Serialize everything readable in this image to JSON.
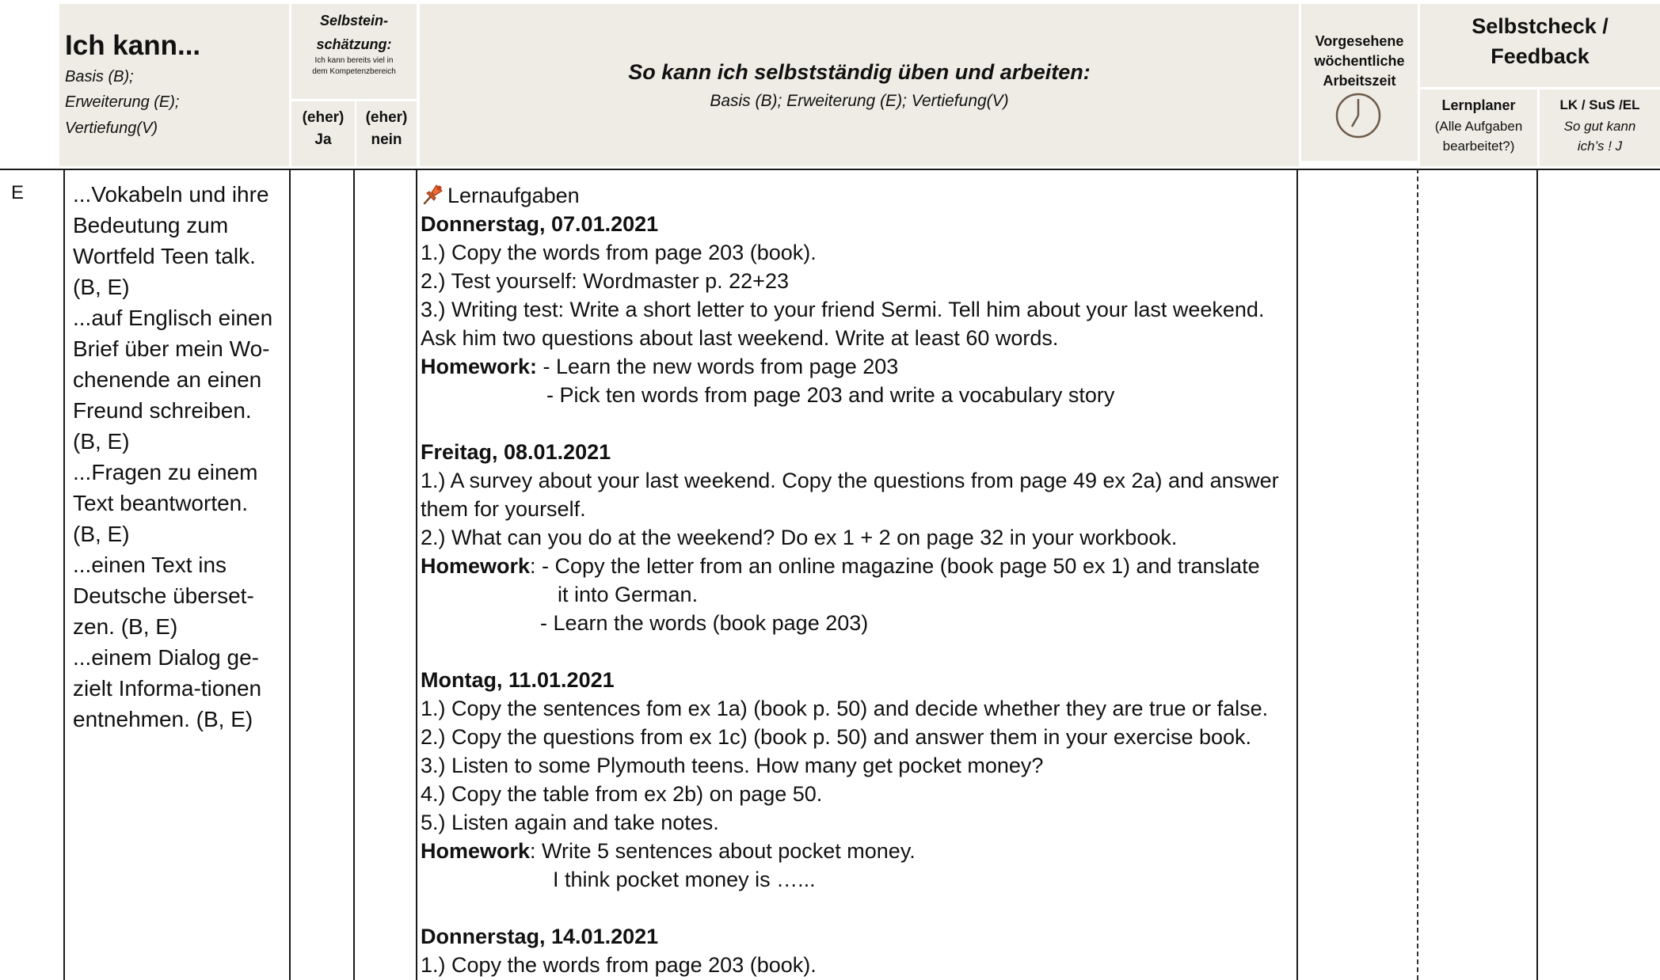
{
  "header": {
    "ich_kann": {
      "title": "Ich kann...",
      "line1": "Basis (B);",
      "line2": "Erweiterung (E);",
      "line3": "Vertiefung(V)"
    },
    "selbst": {
      "title1": "Selbstein-",
      "title2": "schätzung:",
      "small1": "Ich kann bereits viel in",
      "small2": "dem Kompetenzbereich",
      "ja1": "(eher)",
      "ja2": "Ja",
      "nein1": "(eher)",
      "nein2": "nein"
    },
    "uben": {
      "title": "So kann ich selbstständig üben und arbeiten:",
      "sub": "Basis (B); Erweiterung (E); Vertiefung(V)"
    },
    "zeit": {
      "l1": "Vorgesehene",
      "l2": "wöchentliche",
      "l3": "Arbeitszeit",
      "icon": "clock-icon"
    },
    "check": {
      "title1": "Selbstcheck /",
      "title2": "Feedback",
      "lern1": "Lernplaner",
      "lern2": "(Alle Aufgaben",
      "lern3": "bearbeitet?)",
      "lk1": "LK / SuS /EL",
      "lk2": "So gut kann",
      "lk3": "ich’s ! J"
    }
  },
  "row": {
    "level": "E",
    "competences": [
      "...Vokabeln und ihre",
      "Bedeutung zum",
      "Wortfeld Teen talk.",
      "(B, E)",
      "...auf Englisch einen",
      "Brief über mein Wo-",
      "chenende an einen",
      "Freund schreiben.",
      "(B, E)",
      "...Fragen zu einem",
      "Text beantworten.",
      "(B, E)",
      "...einen Text ins",
      "Deutsche überset-",
      "zen. (B, E)",
      "...einem Dialog ge-",
      "zielt Informa-tionen",
      "entnehmen. (B, E)"
    ],
    "tasks": {
      "pin_icon": "pushpin-icon",
      "heading": "Lernaufgaben",
      "day1": {
        "date": "Donnerstag, 07.01.2021",
        "l1": "1.) Copy the words from page 203 (book).",
        "l2": "2.) Test yourself: Wordmaster p. 22+23",
        "l3": "3.) Writing test: Write a short letter to your friend Sermi.  Tell him about your last weekend.",
        "l4": "Ask him two questions about last weekend. Write at least 60 words.",
        "hw_label": "Homework:",
        "hw1": " - Learn the new words from page 203",
        "hw2": "- Pick ten words from page 203 and write a vocabulary story"
      },
      "day2": {
        "date": "Freitag, 08.01.2021",
        "l1": "1.) A survey about your last weekend. Copy the questions from page 49 ex 2a) and answer",
        "l2": "them for yourself.",
        "l3": "2.) What can you do at the weekend? Do ex 1 + 2 on page 32 in your workbook.",
        "hw_label": "Homework",
        "hw1": ":  - Copy the letter from an online magazine (book page 50 ex 1) and translate",
        "hw2": "it into German.",
        "hw3": "- Learn the words (book page 203)"
      },
      "day3": {
        "date": "Montag, 11.01.2021",
        "l1": "1.) Copy the sentences fom ex 1a) (book p. 50) and decide whether they are true or false.",
        "l2": "2.) Copy the questions from ex 1c) (book p. 50) and answer them in your exercise book.",
        "l3": "3.) Listen to some Plymouth teens. How many get pocket money?",
        "l4": "4.) Copy the table from ex 2b) on page 50.",
        "l5": "5.) Listen again and take notes.",
        "hw_label": "Homework",
        "hw1": ":  Write 5 sentences about pocket money.",
        "hw2": "I think pocket money is …..."
      },
      "day4": {
        "date": "Donnerstag, 14.01.2021",
        "l1": "1.) Copy the words from page 203 (book)."
      }
    }
  }
}
